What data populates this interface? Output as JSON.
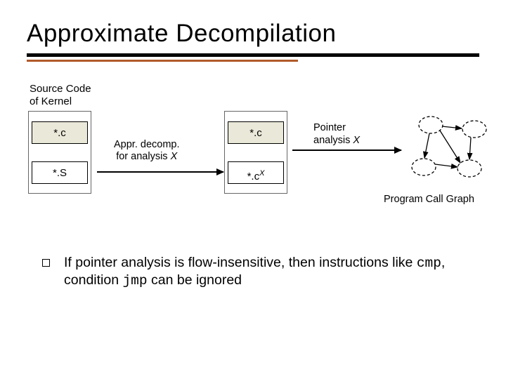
{
  "title": "Approximate Decompilation",
  "source_label_line1": "Source Code",
  "source_label_line2": "of Kernel",
  "box_c": "*.c",
  "box_s": "*.S",
  "box_c2": "*.c",
  "box_cx_prefix": "*.c",
  "box_cx_sup": "X",
  "decomp_line1": "Appr. decomp.",
  "decomp_line2_prefix": "for analysis ",
  "decomp_x": "X",
  "pointer_line1": "Pointer",
  "pointer_line2_prefix": "analysis ",
  "pointer_x": "X",
  "graph_label": "Program Call Graph",
  "bullet_part1": "If pointer analysis is flow-insensitive, then instructions like ",
  "bullet_mono1": "cmp",
  "bullet_part2": ", condition ",
  "bullet_mono2": "jmp",
  "bullet_part3": " can be ignored"
}
